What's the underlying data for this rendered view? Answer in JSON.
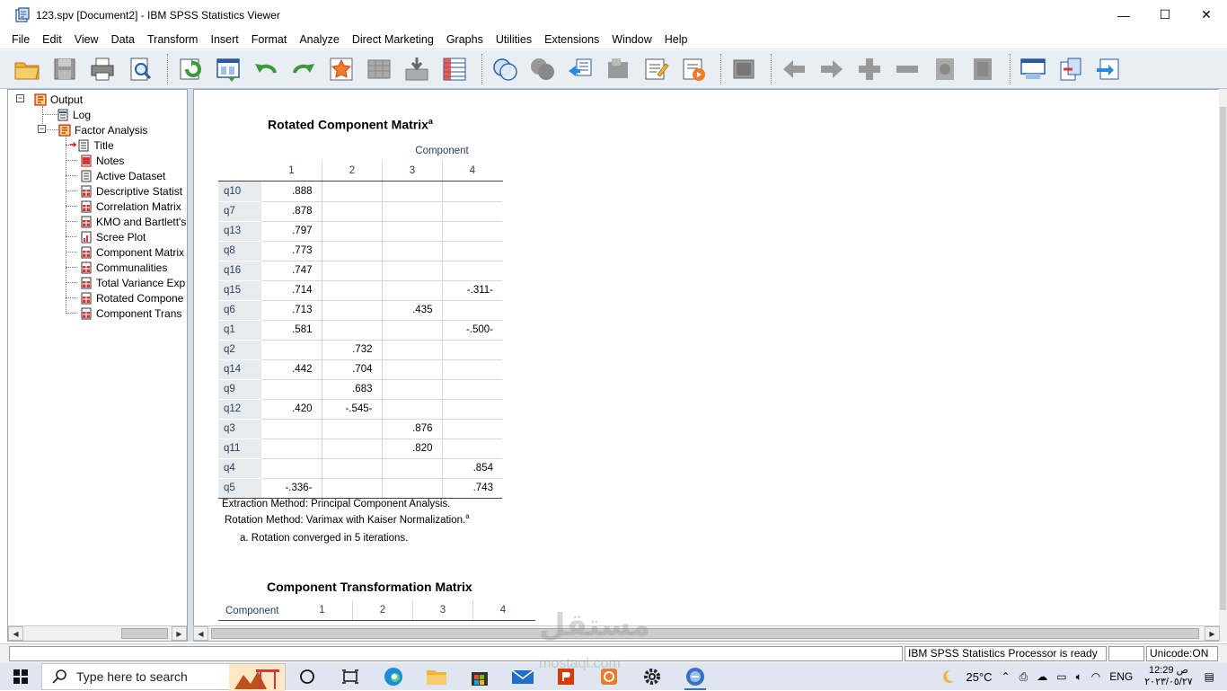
{
  "window": {
    "title": "123.spv [Document2] - IBM SPSS Statistics Viewer",
    "controls": [
      "—",
      "☐",
      "✕"
    ]
  },
  "menu": [
    "File",
    "Edit",
    "View",
    "Data",
    "Transform",
    "Insert",
    "Format",
    "Analyze",
    "Direct Marketing",
    "Graphs",
    "Utilities",
    "Extensions",
    "Window",
    "Help"
  ],
  "toolbar": {
    "icons": [
      "open-folder-icon",
      "save-icon",
      "print-icon",
      "print-preview-icon",
      "export-icon",
      "recall-dialog-icon",
      "undo-icon",
      "redo-icon",
      "goto-data-icon",
      "goto-case-icon",
      "goto-variable-icon",
      "variables-icon",
      "use-variable-sets-icon",
      "show-all-variables-icon",
      "designate-window-icon",
      "select-last-output-icon",
      "insert-heading-icon",
      "insert-title-icon",
      "insert-text-icon",
      "promote-icon",
      "demote-icon",
      "expand-icon",
      "collapse-icon",
      "show-icon",
      "hide-icon",
      "script-icon",
      "paste-icon",
      "export-output-icon"
    ]
  },
  "tree": {
    "nodes": [
      {
        "label": "Output",
        "icon": "output-book-icon"
      },
      {
        "label": "Log",
        "icon": "log-icon"
      },
      {
        "label": "Factor Analysis",
        "icon": "output-book-icon"
      },
      {
        "label": "Title",
        "icon": "title-icon"
      },
      {
        "label": "Notes",
        "icon": "notes-icon"
      },
      {
        "label": "Active Dataset",
        "icon": "text-icon"
      },
      {
        "label": "Descriptive Statist",
        "icon": "table-icon"
      },
      {
        "label": "Correlation Matrix",
        "icon": "table-icon"
      },
      {
        "label": "KMO and Bartlett's",
        "icon": "table-icon"
      },
      {
        "label": "Scree Plot",
        "icon": "chart-icon"
      },
      {
        "label": "Component Matrix",
        "icon": "table-icon"
      },
      {
        "label": "Communalities",
        "icon": "table-icon"
      },
      {
        "label": "Total Variance Exp",
        "icon": "table-icon"
      },
      {
        "label": "Rotated Compone",
        "icon": "table-icon"
      },
      {
        "label": "Component Trans",
        "icon": "table-icon"
      }
    ]
  },
  "rotated": {
    "title": "Rotated Component Matrix",
    "title_sup": "a",
    "header_group": "Component",
    "columns": [
      "1",
      "2",
      "3",
      "4"
    ],
    "rows": [
      {
        "label": "q10",
        "c": [
          ".888",
          "",
          "",
          ""
        ]
      },
      {
        "label": "q7",
        "c": [
          ".878",
          "",
          "",
          ""
        ]
      },
      {
        "label": "q13",
        "c": [
          ".797",
          "",
          "",
          ""
        ]
      },
      {
        "label": "q8",
        "c": [
          ".773",
          "",
          "",
          ""
        ]
      },
      {
        "label": "q16",
        "c": [
          ".747",
          "",
          "",
          ""
        ]
      },
      {
        "label": "q15",
        "c": [
          ".714",
          "",
          "",
          "-.311-"
        ]
      },
      {
        "label": "q6",
        "c": [
          ".713",
          "",
          ".435",
          ""
        ]
      },
      {
        "label": "q1",
        "c": [
          ".581",
          "",
          "",
          "-.500-"
        ]
      },
      {
        "label": "q2",
        "c": [
          "",
          ".732",
          "",
          ""
        ]
      },
      {
        "label": "q14",
        "c": [
          ".442",
          ".704",
          "",
          ""
        ]
      },
      {
        "label": "q9",
        "c": [
          "",
          ".683",
          "",
          ""
        ]
      },
      {
        "label": "q12",
        "c": [
          ".420",
          "-.545-",
          "",
          ""
        ]
      },
      {
        "label": "q3",
        "c": [
          "",
          "",
          ".876",
          ""
        ]
      },
      {
        "label": "q11",
        "c": [
          "",
          "",
          ".820",
          ""
        ]
      },
      {
        "label": "q4",
        "c": [
          "",
          "",
          "",
          ".854"
        ]
      },
      {
        "label": "q5",
        "c": [
          "-.336-",
          "",
          "",
          ".743"
        ]
      }
    ],
    "footnote1": "Extraction Method: Principal Component Analysis.",
    "footnote2": "Rotation Method: Varimax with Kaiser Normalization.",
    "footnote2_sup": "a",
    "footnote3": "a. Rotation converged in 5 iterations."
  },
  "transform": {
    "title": "Component Transformation Matrix",
    "row_header": "Component",
    "columns": [
      "1",
      "2",
      "3",
      "4"
    ]
  },
  "status": {
    "processor": "IBM SPSS Statistics Processor is ready",
    "unicode": "Unicode:ON"
  },
  "taskbar": {
    "search_placeholder": "Type here to search",
    "temperature": "25°C",
    "language": "ENG",
    "time": "12:29 ص",
    "date": "٢٠٢٣/٠٥/٢٧"
  },
  "watermark": {
    "text1": "مستقل",
    "text2": "mostaql.com"
  },
  "colors": {
    "row_label_bg": "#e8ebee",
    "header_text": "#26415e",
    "toolbar_bg": "#e9eef5"
  }
}
